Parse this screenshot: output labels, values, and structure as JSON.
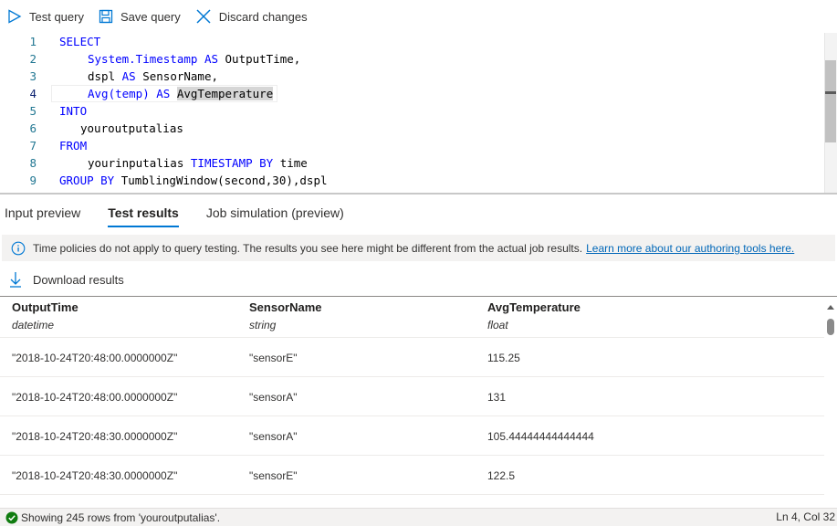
{
  "toolbar": {
    "test_query": "Test query",
    "save_query": "Save query",
    "discard_changes": "Discard changes"
  },
  "editor": {
    "line_numbers": [
      "1",
      "2",
      "3",
      "4",
      "5",
      "6",
      "7",
      "8",
      "9"
    ],
    "lines": [
      {
        "kw1": "SELECT"
      },
      {
        "pre": "System.Timestamp ",
        "kw": "AS",
        "post": " OutputTime,"
      },
      {
        "pre": "dspl ",
        "kw": "AS",
        "post": " SensorName,"
      },
      {
        "pre": "Avg(temp) ",
        "kw": "AS",
        "post_hl": "AvgTemperature"
      },
      {
        "kw1": "INTO"
      },
      {
        "text": "youroutputalias"
      },
      {
        "kw1": "FROM"
      },
      {
        "pre": "yourinputalias ",
        "kw": "TIMESTAMP BY",
        "post": " time"
      },
      {
        "kw": "GROUP BY",
        "post": " TumblingWindow(second,30),dspl"
      }
    ]
  },
  "tabs": [
    "Input preview",
    "Test results",
    "Job simulation (preview)"
  ],
  "active_tab": "Test results",
  "info": {
    "text": "Time policies do not apply to query testing. The results you see here might be different from the actual job results.",
    "link": "Learn more about our authoring tools here."
  },
  "download": "Download results",
  "table": {
    "columns": [
      {
        "name": "OutputTime",
        "type": "datetime"
      },
      {
        "name": "SensorName",
        "type": "string"
      },
      {
        "name": "AvgTemperature",
        "type": "float"
      }
    ],
    "rows": [
      [
        "\"2018-10-24T20:48:00.0000000Z\"",
        "\"sensorE\"",
        "115.25"
      ],
      [
        "\"2018-10-24T20:48:00.0000000Z\"",
        "\"sensorA\"",
        "131"
      ],
      [
        "\"2018-10-24T20:48:30.0000000Z\"",
        "\"sensorA\"",
        "105.44444444444444"
      ],
      [
        "\"2018-10-24T20:48:30.0000000Z\"",
        "\"sensorE\"",
        "122.5"
      ]
    ]
  },
  "status": {
    "message": "Showing 245 rows from 'youroutputalias'.",
    "position": "Ln 4, Col 32"
  },
  "colors": {
    "accent": "#0078d4",
    "keyword": "#0000ff",
    "success": "#107c10"
  }
}
